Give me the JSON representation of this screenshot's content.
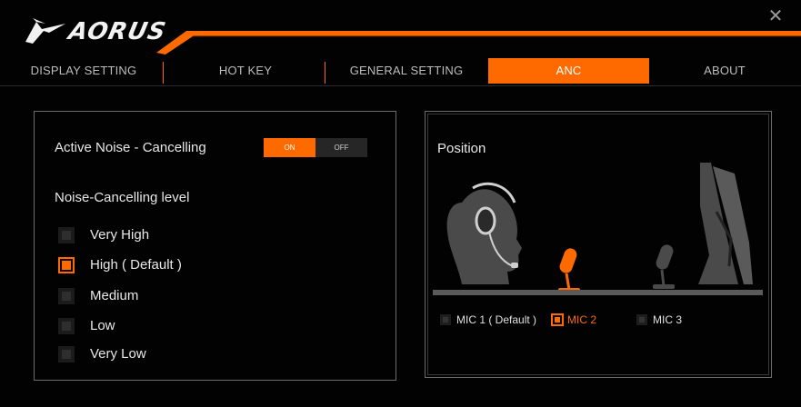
{
  "app": {
    "brand": "AORUS",
    "close_glyph": "✕"
  },
  "tabs": [
    {
      "label": "DISPLAY SETTING",
      "active": false
    },
    {
      "label": "HOT KEY",
      "active": false
    },
    {
      "label": "GENERAL SETTING",
      "active": false
    },
    {
      "label": "ANC",
      "active": true
    },
    {
      "label": "ABOUT",
      "active": false
    }
  ],
  "anc": {
    "label": "Active Noise - Cancelling",
    "toggle_on": "ON",
    "toggle_off": "OFF",
    "enabled": true,
    "level_title": "Noise-Cancelling level",
    "levels": [
      {
        "label": "Very High",
        "checked": false
      },
      {
        "label": "High ( Default )",
        "checked": true
      },
      {
        "label": "Medium",
        "checked": false
      },
      {
        "label": "Low",
        "checked": false
      },
      {
        "label": "Very Low",
        "checked": false
      }
    ]
  },
  "position": {
    "title": "Position",
    "mics": [
      {
        "label": "MIC 1 ( Default )",
        "checked": false
      },
      {
        "label": "MIC 2",
        "checked": true
      },
      {
        "label": "MIC 3",
        "checked": false
      }
    ]
  },
  "colors": {
    "accent": "#ff6a00",
    "background": "#020202",
    "panel_border": "#6c6c6c"
  }
}
